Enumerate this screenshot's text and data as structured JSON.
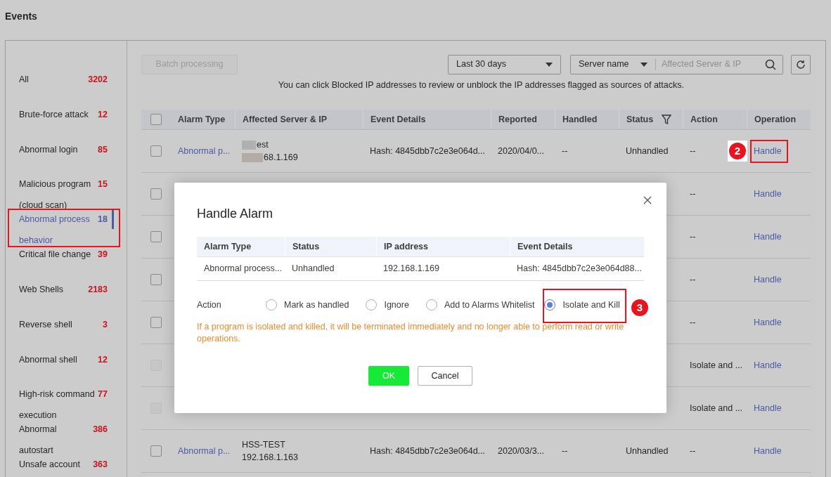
{
  "page": {
    "title": "Events"
  },
  "sidebar": {
    "items": [
      {
        "label": "All",
        "count": "3202",
        "selected": false
      },
      {
        "label": "Brute-force attack",
        "count": "12",
        "selected": false
      },
      {
        "label": "Abnormal login",
        "count": "85",
        "selected": false
      },
      {
        "label": "Malicious program (cloud scan)",
        "count": "15",
        "selected": false
      },
      {
        "label": "Abnormal process behavior",
        "count": "18",
        "selected": true
      },
      {
        "label": "Critical file change",
        "count": "39",
        "selected": false
      },
      {
        "label": "Web Shells",
        "count": "2183",
        "selected": false
      },
      {
        "label": "Reverse shell",
        "count": "3",
        "selected": false
      },
      {
        "label": "Abnormal shell",
        "count": "12",
        "selected": false
      },
      {
        "label": "High-risk command execution",
        "count": "77",
        "selected": false
      },
      {
        "label": "Abnormal autostart",
        "count": "386",
        "selected": false
      },
      {
        "label": "Unsafe account",
        "count": "363",
        "selected": false
      }
    ]
  },
  "toolbar": {
    "batch_button": {
      "label": "Batch processing",
      "disabled": true
    },
    "time_range": "Last 30 days",
    "search_by": "Server name",
    "search": {
      "placeholder": "Affected Server & IP"
    }
  },
  "info_text": "You can click Blocked IP addresses to review or unblock the IP addresses flagged as sources of attacks.",
  "table": {
    "header_checkbox": {
      "checked": false
    },
    "columns": [
      {
        "label": "Alarm Type",
        "filter": false
      },
      {
        "label": "Affected Server & IP",
        "filter": false
      },
      {
        "label": "Event Details",
        "filter": false
      },
      {
        "label": "Reported",
        "filter": false
      },
      {
        "label": "Handled",
        "filter": false
      },
      {
        "label": "Status",
        "filter": true
      },
      {
        "label": "Action",
        "filter": false
      },
      {
        "label": "Operation",
        "filter": false
      }
    ],
    "rows": [
      {
        "disabled": false,
        "alarm_type": "Abnormal p...",
        "server": "est",
        "ip": "68.1.169",
        "redacted": true,
        "details": "Hash: 4845dbb7c2e3e064d...",
        "reported": "2020/04/0...",
        "handled": "--",
        "status": "Unhandled",
        "action": "--",
        "operation": "Handle"
      },
      {
        "disabled": false,
        "action": "--",
        "operation": "Handle"
      },
      {
        "disabled": false,
        "action": "--",
        "operation": "Handle"
      },
      {
        "disabled": false,
        "action": "--",
        "operation": "Handle"
      },
      {
        "disabled": false,
        "action": "--",
        "operation": "Handle"
      },
      {
        "disabled": true,
        "action": "Isolate and ...",
        "operation": "Handle"
      },
      {
        "disabled": true,
        "action": "Isolate and ...",
        "operation": "Handle"
      },
      {
        "disabled": false,
        "alarm_type": "Abnormal p...",
        "server": "HSS-TEST",
        "ip": "192.168.1.163",
        "redacted": false,
        "details": "Hash: 4845dbb7c2e3e064d...",
        "reported": "2020/03/3...",
        "handled": "--",
        "status": "Unhandled",
        "action": "--",
        "operation": "Handle"
      }
    ]
  },
  "dialog": {
    "title": "Handle Alarm",
    "columns": [
      "Alarm Type",
      "Status",
      "IP address",
      "Event Details"
    ],
    "row": [
      "Abnormal process...",
      "Unhandled",
      "192.168.1.169",
      "Hash: 4845dbb7c2e3e064d88..."
    ],
    "action_label": "Action",
    "options": [
      {
        "label": "Mark as handled",
        "selected": false
      },
      {
        "label": "Ignore",
        "selected": false
      },
      {
        "label": "Add to Alarms Whitelist",
        "selected": false
      },
      {
        "label": "Isolate and Kill",
        "selected": true
      }
    ],
    "warning": "If a program is isolated and killed, it will be terminated immediately and no longer able to perform read or write operations.",
    "buttons": [
      {
        "label": "OK",
        "kind": "primary"
      },
      {
        "label": "Cancel",
        "kind": "secondary"
      }
    ]
  },
  "callouts": [
    {
      "label": "2"
    },
    {
      "label": "3"
    }
  ]
}
